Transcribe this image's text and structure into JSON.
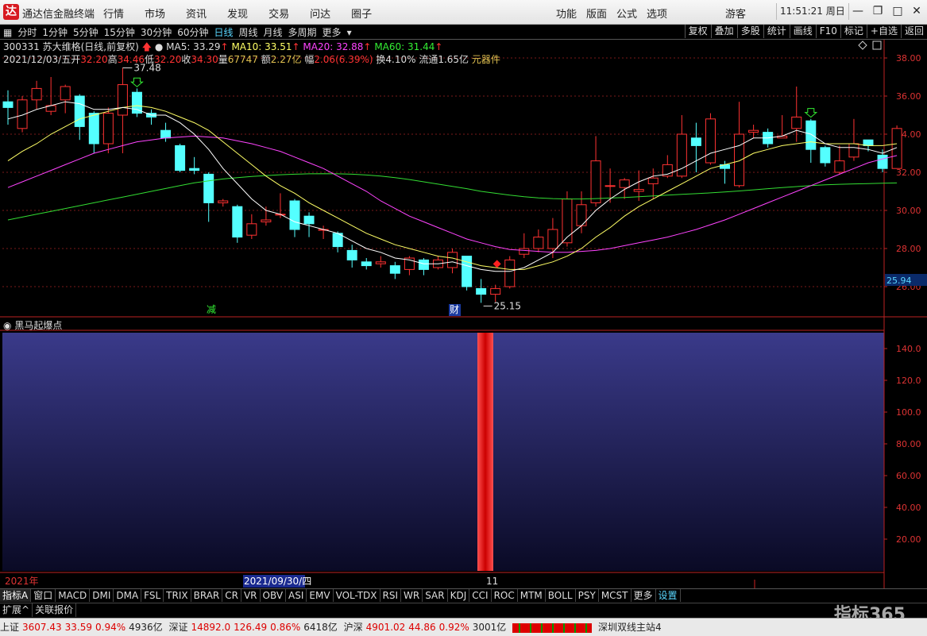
{
  "app": {
    "logo_text": "达",
    "title": "通达信金融终端",
    "menu": [
      "行情",
      "市场",
      "资讯",
      "发现",
      "交易",
      "问达",
      "圈子"
    ],
    "right_menu": [
      "功能",
      "版面",
      "公式",
      "选项"
    ],
    "guest": "游客",
    "clock": "11:51:21 周日"
  },
  "toolbar": {
    "periods": [
      "分时",
      "1分钟",
      "5分钟",
      "15分钟",
      "30分钟",
      "60分钟",
      "日线",
      "周线",
      "月线",
      "多周期",
      "更多"
    ],
    "active_period": "日线",
    "right_buttons": [
      "复权",
      "叠加",
      "多股",
      "统计",
      "画线",
      "F10",
      "标记",
      "+自选",
      "返回"
    ]
  },
  "header": {
    "code_name": "300331 苏大维格(日线,前复权)",
    "ma5": "MA5: 33.29",
    "ma10": "MA10: 33.51",
    "ma20": "MA20: 32.88",
    "ma60": "MA60: 31.44",
    "date": "2021/12/03/五",
    "open_label": "开",
    "open": "32.20",
    "high_label": "高",
    "high": "34.46",
    "low_label": "低",
    "low": "32.20",
    "close_label": "收",
    "close": "34.30",
    "volume_label": "量",
    "volume": "67747",
    "amount_label": "额",
    "amount": "2.27亿",
    "change_label": "幅",
    "change": "2.06(6.39%)",
    "turnover": "换4.10%",
    "float": "流通1.65亿",
    "sector": "元器件"
  },
  "price_axis": {
    "labels": [
      "38.00",
      "36.00",
      "34.00",
      "32.00",
      "30.00",
      "28.00",
      "26.00"
    ],
    "current_price": "25.94"
  },
  "annotations": {
    "max_price": "37.48",
    "min_price": "25.15",
    "tag_jian": "减",
    "tag_cai": "财"
  },
  "indicator": {
    "name": "黑马起爆点",
    "axis_labels": [
      "140.0",
      "120.0",
      "100.0",
      "80.00",
      "60.00",
      "40.00",
      "20.00"
    ]
  },
  "time_axis": {
    "year": "2021年",
    "date_marker": "2021/09/30/四",
    "month": "11"
  },
  "indicator_tabs": [
    "指标A",
    "窗口",
    "MACD",
    "DMI",
    "DMA",
    "FSL",
    "TRIX",
    "BRAR",
    "CR",
    "VR",
    "OBV",
    "ASI",
    "EMV",
    "VOL-TDX",
    "RSI",
    "WR",
    "SAR",
    "KDJ",
    "CCI",
    "ROC",
    "MTM",
    "BOLL",
    "PSY",
    "MCST",
    "更多",
    "设置"
  ],
  "bottom_row": [
    "扩展^",
    "关联报价"
  ],
  "status": {
    "sh_label": "上证",
    "sh_index": "3607.43",
    "sh_change": "33.59",
    "sh_pct": "0.94%",
    "sh_amount": "4936亿",
    "sz_label": "深证",
    "sz_index": "14892.0",
    "sz_change": "126.49",
    "sz_pct": "0.86%",
    "sz_amount": "6418亿",
    "hs_label": "沪深",
    "hs_index": "4901.02",
    "hs_change": "44.86",
    "hs_pct": "0.92%",
    "hs_amount": "3001亿",
    "server": "深圳双线主站4"
  },
  "watermark": "指标365",
  "colors": {
    "up": "#ff3232",
    "down": "#54ffff",
    "ma5": "#ffffff",
    "ma10": "#ffff66",
    "ma20": "#ff44ff",
    "ma60": "#33dd33"
  },
  "chart_data": {
    "type": "candlestick",
    "ylim": [
      25,
      38.8
    ],
    "candles": [
      [
        35.7,
        35.4,
        36.3,
        34.5
      ],
      [
        34.3,
        35.8,
        36.0,
        34.1
      ],
      [
        35.8,
        36.4,
        36.8,
        35.3
      ],
      [
        35.2,
        35.5,
        37.0,
        35.0
      ],
      [
        35.8,
        36.5,
        36.6,
        35.1
      ],
      [
        36.0,
        34.4,
        36.1,
        33.7
      ],
      [
        35.1,
        33.5,
        35.2,
        33.0
      ],
      [
        33.5,
        35.1,
        35.4,
        33.0
      ],
      [
        35.0,
        36.6,
        37.48,
        33.0
      ],
      [
        36.2,
        35.1,
        36.4,
        34.9
      ],
      [
        35.1,
        34.9,
        35.3,
        34.5
      ],
      [
        34.2,
        33.8,
        34.6,
        33.6
      ],
      [
        33.4,
        32.1,
        33.5,
        32.0
      ],
      [
        32.2,
        32.1,
        32.8,
        31.9
      ],
      [
        31.9,
        30.4,
        32.0,
        29.4
      ],
      [
        30.4,
        30.5,
        30.6,
        30.2
      ],
      [
        30.2,
        28.6,
        30.3,
        28.3
      ],
      [
        28.7,
        29.3,
        29.8,
        28.5
      ],
      [
        29.4,
        29.5,
        30.2,
        29.2
      ],
      [
        29.8,
        29.8,
        30.9,
        29.6
      ],
      [
        30.5,
        29.0,
        30.6,
        28.6
      ],
      [
        29.7,
        29.3,
        29.9,
        28.6
      ],
      [
        29.0,
        29.0,
        29.2,
        28.5
      ],
      [
        28.8,
        28.1,
        28.9,
        27.8
      ],
      [
        27.9,
        27.4,
        28.2,
        27.0
      ],
      [
        27.3,
        27.1,
        27.5,
        26.9
      ],
      [
        27.2,
        27.3,
        27.6,
        27.0
      ],
      [
        27.1,
        26.7,
        27.3,
        26.4
      ],
      [
        26.9,
        27.5,
        27.6,
        26.6
      ],
      [
        27.4,
        26.9,
        27.5,
        26.6
      ],
      [
        27.0,
        27.4,
        27.6,
        26.9
      ],
      [
        27.0,
        27.8,
        28.0,
        26.7
      ],
      [
        27.6,
        26.0,
        27.6,
        25.8
      ],
      [
        25.9,
        25.6,
        26.4,
        25.15
      ],
      [
        25.6,
        25.9,
        26.1,
        25.2
      ],
      [
        26.0,
        27.4,
        27.6,
        25.9
      ],
      [
        27.7,
        28.0,
        28.8,
        27.5
      ],
      [
        28.0,
        28.6,
        29.0,
        27.8
      ],
      [
        28.0,
        29.0,
        29.6,
        27.5
      ],
      [
        28.3,
        30.6,
        31.0,
        28.1
      ],
      [
        29.2,
        30.3,
        31.0,
        28.8
      ],
      [
        30.4,
        32.6,
        33.9,
        30.2
      ],
      [
        31.3,
        31.3,
        32.2,
        30.4
      ],
      [
        31.2,
        31.6,
        31.7,
        30.6
      ],
      [
        31.0,
        31.1,
        32.1,
        30.5
      ],
      [
        31.4,
        31.7,
        32.2,
        30.6
      ],
      [
        31.8,
        32.4,
        32.9,
        31.7
      ],
      [
        31.8,
        34.0,
        35.0,
        31.7
      ],
      [
        33.8,
        33.4,
        34.6,
        32.0
      ],
      [
        32.5,
        34.8,
        35.1,
        32.4
      ],
      [
        32.4,
        32.2,
        32.6,
        31.4
      ],
      [
        31.3,
        34.0,
        35.7,
        31.2
      ],
      [
        34.1,
        34.2,
        34.5,
        33.8
      ],
      [
        34.1,
        33.5,
        34.3,
        33.3
      ],
      [
        33.8,
        33.9,
        35.0,
        33.8
      ],
      [
        34.3,
        34.9,
        36.5,
        33.6
      ],
      [
        34.7,
        33.2,
        34.8,
        32.5
      ],
      [
        33.3,
        32.5,
        33.4,
        32.3
      ],
      [
        32.0,
        32.6,
        33.4,
        31.9
      ],
      [
        32.8,
        33.5,
        34.8,
        32.6
      ],
      [
        33.7,
        33.4,
        33.7,
        33.1
      ],
      [
        32.9,
        32.2,
        33.2,
        32.0
      ],
      [
        32.2,
        34.3,
        34.46,
        32.2
      ]
    ],
    "ma5": [
      34.8,
      35.0,
      35.3,
      35.5,
      35.7,
      35.6,
      35.3,
      35.3,
      35.4,
      35.3,
      35.0,
      35.0,
      34.6,
      34.0,
      33.2,
      32.2,
      31.4,
      30.6,
      30.0,
      29.8,
      29.4,
      29.2,
      29.0,
      28.8,
      28.4,
      28.0,
      27.8,
      27.5,
      27.4,
      27.2,
      27.2,
      27.3,
      27.1,
      26.9,
      26.8,
      26.8,
      27.0,
      27.4,
      27.8,
      28.6,
      29.2,
      30.0,
      30.6,
      31.1,
      31.5,
      31.8,
      31.9,
      32.2,
      32.6,
      33.0,
      33.2,
      33.4,
      33.8,
      33.8,
      33.9,
      34.2,
      34.0,
      33.5,
      33.3,
      33.3,
      33.2,
      33.0,
      33.3
    ],
    "ma10": [
      32.6,
      33.1,
      33.5,
      34.0,
      34.4,
      34.8,
      35.0,
      35.2,
      35.4,
      35.5,
      35.4,
      35.2,
      34.9,
      34.6,
      34.2,
      33.6,
      33.0,
      32.4,
      31.8,
      31.3,
      30.9,
      30.4,
      30.0,
      29.6,
      29.2,
      28.8,
      28.5,
      28.2,
      28.0,
      27.8,
      27.6,
      27.5,
      27.3,
      27.1,
      27.0,
      26.9,
      26.9,
      27.1,
      27.3,
      27.6,
      28.0,
      28.6,
      29.1,
      29.7,
      30.2,
      30.6,
      31.0,
      31.4,
      31.8,
      32.2,
      32.4,
      32.6,
      33.0,
      33.2,
      33.4,
      33.5,
      33.6,
      33.5,
      33.5,
      33.5,
      33.4,
      33.4,
      33.5
    ],
    "ma20": [
      31.2,
      31.5,
      31.8,
      32.1,
      32.4,
      32.7,
      33.0,
      33.2,
      33.4,
      33.6,
      33.7,
      33.8,
      33.85,
      33.9,
      33.85,
      33.8,
      33.65,
      33.5,
      33.3,
      33.1,
      32.8,
      32.5,
      32.2,
      31.8,
      31.4,
      31.0,
      30.5,
      30.1,
      29.7,
      29.4,
      29.1,
      28.8,
      28.5,
      28.3,
      28.1,
      27.95,
      27.9,
      27.85,
      27.8,
      27.8,
      27.85,
      27.9,
      28.0,
      28.15,
      28.3,
      28.45,
      28.6,
      28.8,
      29.0,
      29.25,
      29.5,
      29.8,
      30.1,
      30.4,
      30.7,
      31.0,
      31.3,
      31.6,
      31.9,
      32.2,
      32.5,
      32.7,
      32.88
    ],
    "ma60": [
      29.5,
      29.65,
      29.8,
      29.95,
      30.1,
      30.25,
      30.4,
      30.55,
      30.7,
      30.85,
      31.0,
      31.15,
      31.3,
      31.45,
      31.55,
      31.65,
      31.72,
      31.78,
      31.83,
      31.87,
      31.9,
      31.92,
      31.93,
      31.92,
      31.9,
      31.86,
      31.8,
      31.72,
      31.62,
      31.5,
      31.38,
      31.26,
      31.14,
      31.0,
      30.9,
      30.8,
      30.72,
      30.66,
      30.62,
      30.6,
      30.6,
      30.62,
      30.65,
      30.68,
      30.72,
      30.76,
      30.8,
      30.84,
      30.88,
      30.92,
      30.97,
      31.02,
      31.08,
      31.14,
      31.2,
      31.25,
      31.3,
      31.34,
      31.37,
      31.39,
      31.41,
      31.43,
      31.44
    ]
  }
}
